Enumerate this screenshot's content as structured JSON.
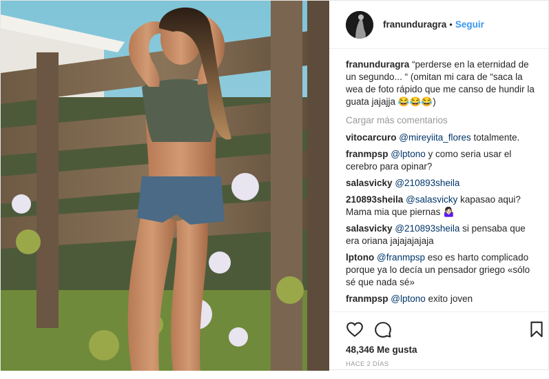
{
  "post": {
    "author": "franunduragra",
    "dot": "•",
    "follow_label": "Seguir",
    "image_icon": "photo-of-woman-by-wooden-fence"
  },
  "caption": {
    "user": "franunduragra",
    "text": "“perderse en la eternidad de un segundo... “ (omitan mi cara de “saca la wea de foto rápido que me canso de hundir la guata jajajja 😂😂😂)"
  },
  "load_more": "Cargar más comentarios",
  "comments": [
    {
      "user": "vitocarcuro",
      "mention": "@mireyiita_flores",
      "text": "totalmente."
    },
    {
      "user": "franmpsp",
      "mention": "@lptono",
      "text": "y como seria usar el cerebro para opinar?"
    },
    {
      "user": "salasvicky",
      "mention": "@210893sheila",
      "text": ""
    },
    {
      "user": "210893sheila",
      "mention": "@salasvicky",
      "text": "kapasao aqui? Mama mia que piernas 🤷🏻‍♀️"
    },
    {
      "user": "salasvicky",
      "mention": "@210893sheila",
      "text": "si pensaba que era oriana jajajajajaja"
    },
    {
      "user": "lptono",
      "mention": "@franmpsp",
      "text": "eso es harto complicado porque ya lo decía un pensador griego «sólo sé que nada sé»"
    },
    {
      "user": "franmpsp",
      "mention": "@lptono",
      "text": "exito joven"
    }
  ],
  "actions": {
    "like_icon": "heart-icon",
    "comment_icon": "comment-icon",
    "save_icon": "bookmark-icon"
  },
  "likes": "48,346 Me gusta",
  "time": "HACE 2 DÍAS",
  "colors": {
    "link": "#3897f0",
    "mention": "#003569",
    "muted": "#999999",
    "border": "#efefef"
  }
}
